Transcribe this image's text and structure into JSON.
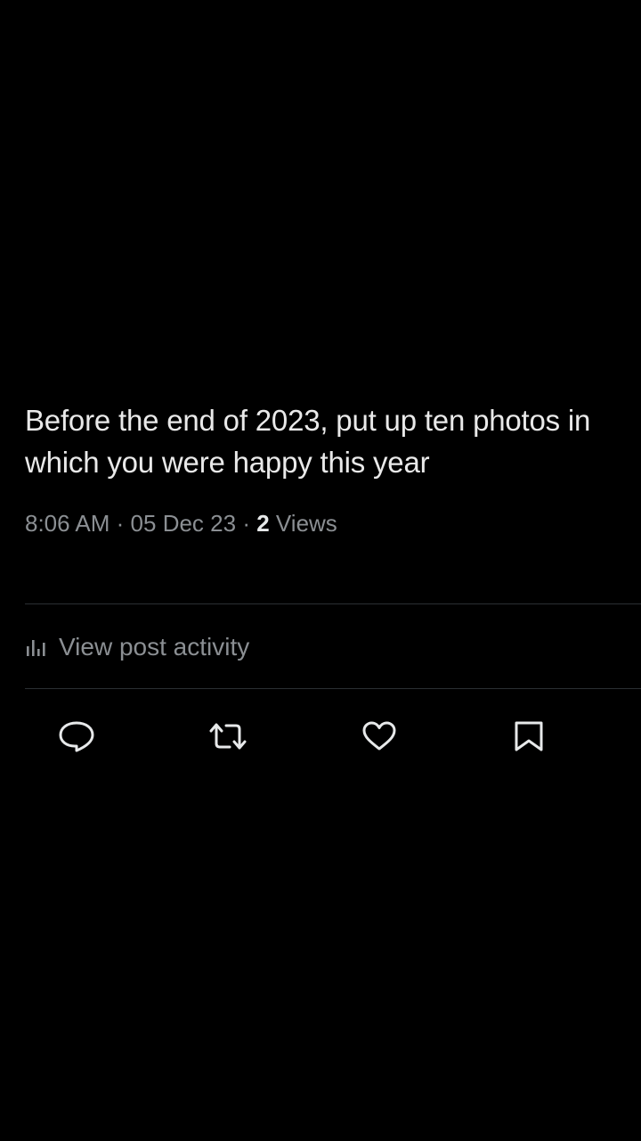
{
  "post": {
    "text": "Before the end of 2023, put up ten photos in which you were happy this year",
    "time": "8:06 AM",
    "separator": "·",
    "date": "05 Dec 23",
    "views_count": "2",
    "views_label": "Views"
  },
  "activity": {
    "label": "View post activity",
    "icon": "bar-chart-icon"
  },
  "actions": {
    "reply_icon": "reply-bubble-icon",
    "repost_icon": "repost-icon",
    "like_icon": "heart-icon",
    "bookmark_icon": "bookmark-icon"
  },
  "colors": {
    "background": "#000000",
    "text_primary": "#e9e9e9",
    "text_secondary": "#8b8f93",
    "divider": "#2b2f33"
  }
}
